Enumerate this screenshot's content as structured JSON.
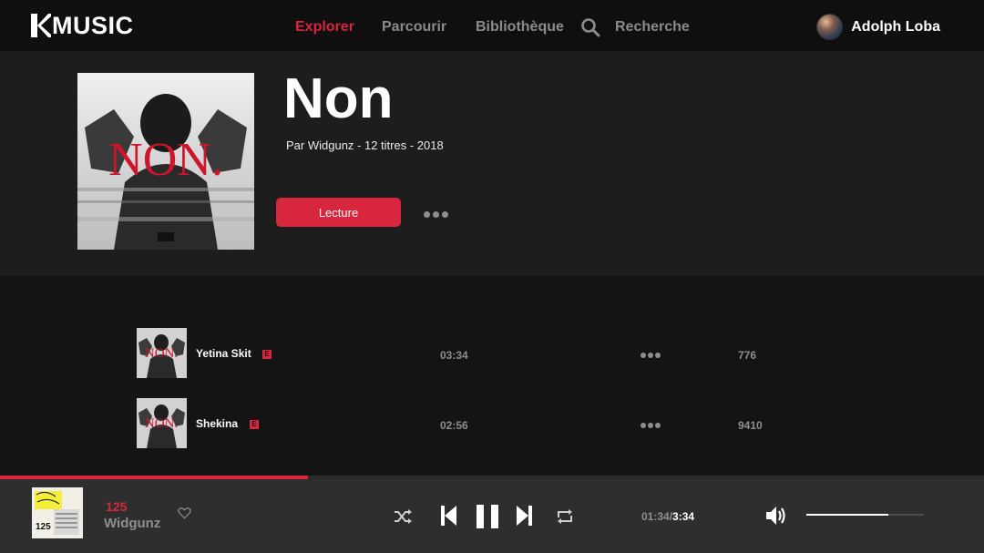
{
  "brand": {
    "name": "MUSIC"
  },
  "nav": {
    "items": [
      {
        "label": "Explorer",
        "active": true
      },
      {
        "label": "Parcourir",
        "active": false
      },
      {
        "label": "Bibliothèque",
        "active": false
      },
      {
        "label": "Recherche",
        "active": false
      }
    ],
    "search_icon": "search-icon"
  },
  "user": {
    "name": "Adolph Loba",
    "avatar_icon": "avatar"
  },
  "album": {
    "title": "Non",
    "meta": "Par Widgunz - 12 titres - 2018",
    "cover_text": "NON.",
    "play_label": "Lecture",
    "more_icon": "more-icon"
  },
  "tracks": [
    {
      "title": "Yetina Skit",
      "explicit": "E",
      "duration": "03:34",
      "plays": "776"
    },
    {
      "title": "Shekina",
      "explicit": "E",
      "duration": "02:56",
      "plays": "9410"
    }
  ],
  "player": {
    "title": "125",
    "artist": "Widgunz",
    "cover_text": "125",
    "current_time": "01:34",
    "separator": "/",
    "total_time": "3:34",
    "progress": 0.313,
    "volume": 0.7,
    "icons": [
      "heart-icon",
      "shuffle-icon",
      "previous-icon",
      "pause-icon",
      "next-icon",
      "repeat-icon",
      "volume-icon"
    ]
  },
  "colors": {
    "accent": "#d7263d",
    "background": "#141415",
    "hero_background": "#1d1d1e",
    "player_background": "#2e2e2f",
    "muted_text": "#8e8e90"
  }
}
